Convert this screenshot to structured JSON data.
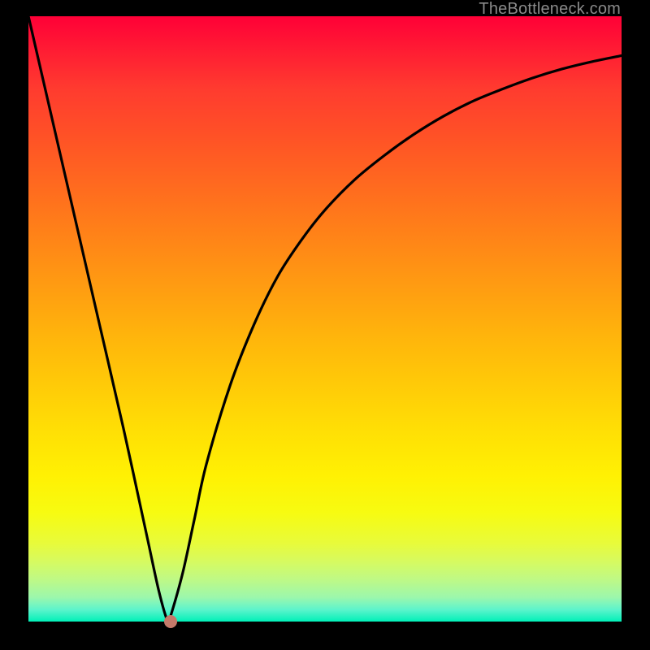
{
  "watermark": "TheBottleneck.com",
  "chart_data": {
    "type": "line",
    "title": "",
    "xlabel": "",
    "ylabel": "",
    "xlim": [
      0,
      100
    ],
    "ylim": [
      0,
      100
    ],
    "grid": false,
    "legend": false,
    "background_gradient": {
      "direction": "vertical",
      "stops": [
        {
          "pos": 0,
          "color": "#ff0037"
        },
        {
          "pos": 50,
          "color": "#ff9a12"
        },
        {
          "pos": 80,
          "color": "#fff103"
        },
        {
          "pos": 100,
          "color": "#00f0b8"
        }
      ]
    },
    "series": [
      {
        "name": "bottleneck-curve",
        "color": "#000000",
        "x": [
          0,
          4,
          8,
          12,
          16,
          20,
          22,
          23.5,
          24,
          26,
          28,
          30,
          34,
          38,
          42,
          46,
          50,
          55,
          60,
          65,
          70,
          75,
          80,
          85,
          90,
          95,
          100
        ],
        "y": [
          100,
          83,
          66,
          49,
          32,
          14,
          5,
          0,
          1,
          8,
          17,
          26,
          39,
          49,
          57,
          63,
          68,
          73,
          77,
          80.5,
          83.5,
          86,
          88,
          89.8,
          91.3,
          92.5,
          93.5
        ]
      }
    ],
    "marker": {
      "x": 24,
      "y": 0,
      "color": "#c47a6a"
    }
  }
}
